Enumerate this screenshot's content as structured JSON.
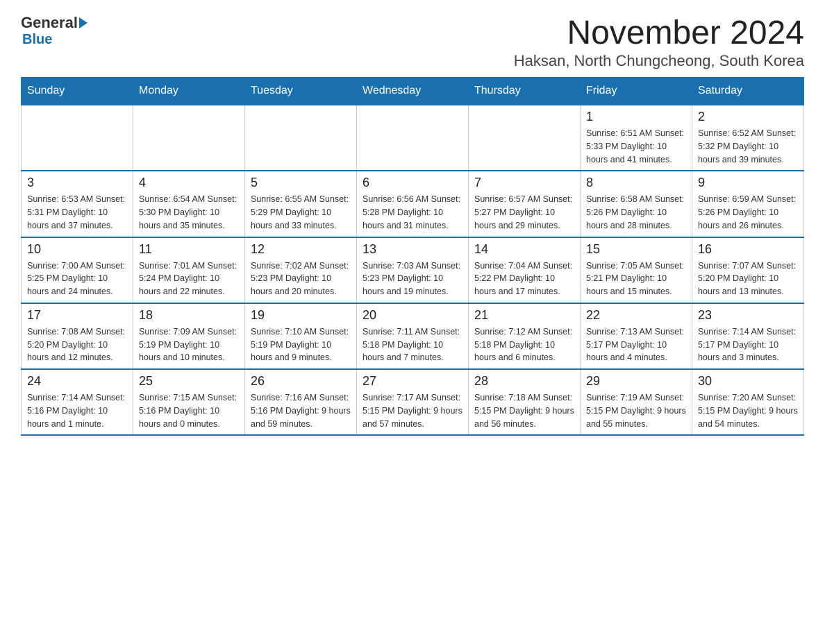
{
  "header": {
    "logo_general": "General",
    "logo_blue": "Blue",
    "month_title": "November 2024",
    "location": "Haksan, North Chungcheong, South Korea"
  },
  "weekdays": [
    "Sunday",
    "Monday",
    "Tuesday",
    "Wednesday",
    "Thursday",
    "Friday",
    "Saturday"
  ],
  "weeks": [
    [
      {
        "day": "",
        "info": ""
      },
      {
        "day": "",
        "info": ""
      },
      {
        "day": "",
        "info": ""
      },
      {
        "day": "",
        "info": ""
      },
      {
        "day": "",
        "info": ""
      },
      {
        "day": "1",
        "info": "Sunrise: 6:51 AM\nSunset: 5:33 PM\nDaylight: 10 hours and 41 minutes."
      },
      {
        "day": "2",
        "info": "Sunrise: 6:52 AM\nSunset: 5:32 PM\nDaylight: 10 hours and 39 minutes."
      }
    ],
    [
      {
        "day": "3",
        "info": "Sunrise: 6:53 AM\nSunset: 5:31 PM\nDaylight: 10 hours and 37 minutes."
      },
      {
        "day": "4",
        "info": "Sunrise: 6:54 AM\nSunset: 5:30 PM\nDaylight: 10 hours and 35 minutes."
      },
      {
        "day": "5",
        "info": "Sunrise: 6:55 AM\nSunset: 5:29 PM\nDaylight: 10 hours and 33 minutes."
      },
      {
        "day": "6",
        "info": "Sunrise: 6:56 AM\nSunset: 5:28 PM\nDaylight: 10 hours and 31 minutes."
      },
      {
        "day": "7",
        "info": "Sunrise: 6:57 AM\nSunset: 5:27 PM\nDaylight: 10 hours and 29 minutes."
      },
      {
        "day": "8",
        "info": "Sunrise: 6:58 AM\nSunset: 5:26 PM\nDaylight: 10 hours and 28 minutes."
      },
      {
        "day": "9",
        "info": "Sunrise: 6:59 AM\nSunset: 5:26 PM\nDaylight: 10 hours and 26 minutes."
      }
    ],
    [
      {
        "day": "10",
        "info": "Sunrise: 7:00 AM\nSunset: 5:25 PM\nDaylight: 10 hours and 24 minutes."
      },
      {
        "day": "11",
        "info": "Sunrise: 7:01 AM\nSunset: 5:24 PM\nDaylight: 10 hours and 22 minutes."
      },
      {
        "day": "12",
        "info": "Sunrise: 7:02 AM\nSunset: 5:23 PM\nDaylight: 10 hours and 20 minutes."
      },
      {
        "day": "13",
        "info": "Sunrise: 7:03 AM\nSunset: 5:23 PM\nDaylight: 10 hours and 19 minutes."
      },
      {
        "day": "14",
        "info": "Sunrise: 7:04 AM\nSunset: 5:22 PM\nDaylight: 10 hours and 17 minutes."
      },
      {
        "day": "15",
        "info": "Sunrise: 7:05 AM\nSunset: 5:21 PM\nDaylight: 10 hours and 15 minutes."
      },
      {
        "day": "16",
        "info": "Sunrise: 7:07 AM\nSunset: 5:20 PM\nDaylight: 10 hours and 13 minutes."
      }
    ],
    [
      {
        "day": "17",
        "info": "Sunrise: 7:08 AM\nSunset: 5:20 PM\nDaylight: 10 hours and 12 minutes."
      },
      {
        "day": "18",
        "info": "Sunrise: 7:09 AM\nSunset: 5:19 PM\nDaylight: 10 hours and 10 minutes."
      },
      {
        "day": "19",
        "info": "Sunrise: 7:10 AM\nSunset: 5:19 PM\nDaylight: 10 hours and 9 minutes."
      },
      {
        "day": "20",
        "info": "Sunrise: 7:11 AM\nSunset: 5:18 PM\nDaylight: 10 hours and 7 minutes."
      },
      {
        "day": "21",
        "info": "Sunrise: 7:12 AM\nSunset: 5:18 PM\nDaylight: 10 hours and 6 minutes."
      },
      {
        "day": "22",
        "info": "Sunrise: 7:13 AM\nSunset: 5:17 PM\nDaylight: 10 hours and 4 minutes."
      },
      {
        "day": "23",
        "info": "Sunrise: 7:14 AM\nSunset: 5:17 PM\nDaylight: 10 hours and 3 minutes."
      }
    ],
    [
      {
        "day": "24",
        "info": "Sunrise: 7:14 AM\nSunset: 5:16 PM\nDaylight: 10 hours and 1 minute."
      },
      {
        "day": "25",
        "info": "Sunrise: 7:15 AM\nSunset: 5:16 PM\nDaylight: 10 hours and 0 minutes."
      },
      {
        "day": "26",
        "info": "Sunrise: 7:16 AM\nSunset: 5:16 PM\nDaylight: 9 hours and 59 minutes."
      },
      {
        "day": "27",
        "info": "Sunrise: 7:17 AM\nSunset: 5:15 PM\nDaylight: 9 hours and 57 minutes."
      },
      {
        "day": "28",
        "info": "Sunrise: 7:18 AM\nSunset: 5:15 PM\nDaylight: 9 hours and 56 minutes."
      },
      {
        "day": "29",
        "info": "Sunrise: 7:19 AM\nSunset: 5:15 PM\nDaylight: 9 hours and 55 minutes."
      },
      {
        "day": "30",
        "info": "Sunrise: 7:20 AM\nSunset: 5:15 PM\nDaylight: 9 hours and 54 minutes."
      }
    ]
  ]
}
